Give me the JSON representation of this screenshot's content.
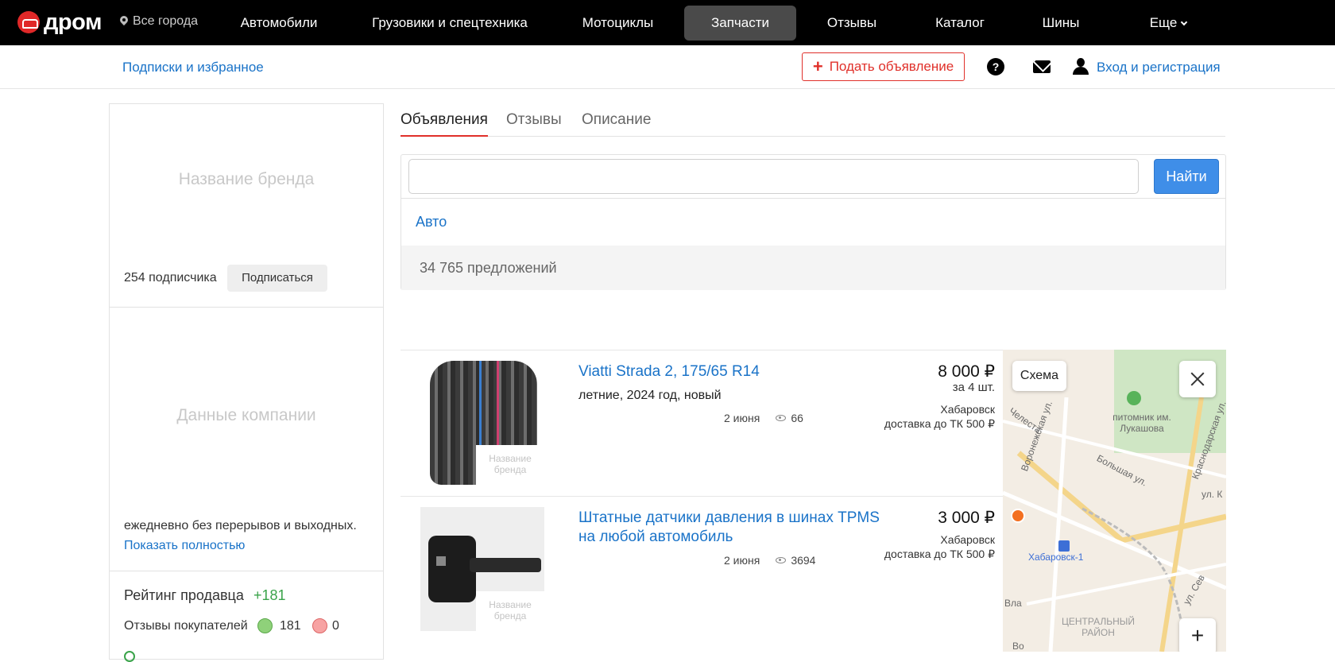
{
  "nav": {
    "logo": "дром",
    "city": "Все города",
    "items": [
      "Автомобили",
      "Грузовики и спецтехника",
      "Мотоциклы",
      "Запчасти",
      "Отзывы",
      "Каталог",
      "Шины",
      "Еще"
    ],
    "active_index": 3
  },
  "subheader": {
    "subscriptions": "Подписки и избранное",
    "post_ad": "Подать объявление",
    "help": "?",
    "login": "Вход и регистрация"
  },
  "sidebar": {
    "brand_placeholder": "Название бренда",
    "subscribers": "254 подписчика",
    "subscribe_button": "Подписаться",
    "company_placeholder": "Данные компании",
    "hours": "ежедневно без перерывов и выходных.",
    "show_all": "Показать полностью",
    "rating_label": "Рейтинг продавца",
    "rating_value": "+181",
    "reviews_label": "Отзывы покупателей",
    "reviews_positive": "181",
    "reviews_negative": "0"
  },
  "tabs": [
    "Объявления",
    "Отзывы",
    "Описание"
  ],
  "search": {
    "value": "",
    "button": "Найти",
    "category": "Авто",
    "offers_count": "34 765 предложений"
  },
  "listings": [
    {
      "title": "Viatti Strada 2, 175/65 R14",
      "spec": "летние, 2024 год, новый",
      "date": "2 июня",
      "views": "66",
      "price": "8 000 ₽",
      "qty": "за 4 шт.",
      "city": "Хабаровск",
      "delivery": "доставка до ТК 500 ₽",
      "badge": "Название бренда"
    },
    {
      "title": "Штатные датчики давления в шинах TPMS на любой автомобиль",
      "spec": "",
      "date": "2 июня",
      "views": "3694",
      "price": "3 000 ₽",
      "qty": "",
      "city": "Хабаровск",
      "delivery": "доставка до ТК 500 ₽",
      "badge": "Название бренда"
    }
  ],
  "map": {
    "schema_button": "Схема",
    "zoom_in": "+",
    "labels": {
      "nursery": "питомник им. Лукашова",
      "street_voronezh": "Воронежская ул.",
      "street_bolshaya": "Большая ул.",
      "street_krasnodar": "Краснодарская ул.",
      "street_chelesta": "Челеста",
      "street_ulk": "ул. К",
      "station": "Хабаровск-1",
      "district": "ЦЕНТРАЛЬНЫЙ РАЙОН",
      "street_sev": "ул. Сев",
      "street_vla": "Вла",
      "street_vo": "Во"
    }
  }
}
